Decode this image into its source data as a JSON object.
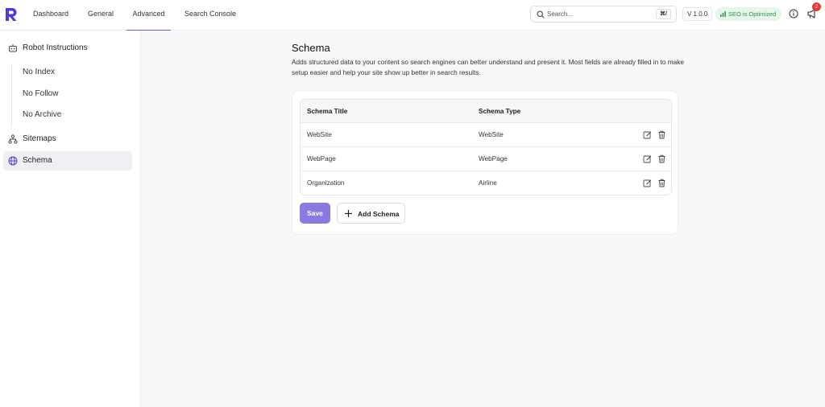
{
  "header": {
    "nav": [
      "Dashboard",
      "General",
      "Advanced",
      "Search Console"
    ],
    "active_tab": "Advanced",
    "search_placeholder": "Search...",
    "shortcut": "⌘/",
    "version": "V 1.0.0",
    "seo_status": "SEO is Optimized",
    "notification_count": "2",
    "accent_color": "#6b5cd6"
  },
  "sidebar": {
    "robot": "Robot Instructions",
    "robot_items": [
      "No Index",
      "No Follow",
      "No Archive"
    ],
    "sitemaps": "Sitemaps",
    "schema": "Schema"
  },
  "main": {
    "title": "Schema",
    "description": "Adds structured data to your content so search engines can better understand and present it. Most fields are already filled in to make setup easier and help your site show up better in search results.",
    "columns": [
      "Schema Title",
      "Schema Type"
    ],
    "rows": [
      {
        "title": "WebSite",
        "type": "WebSite"
      },
      {
        "title": "WebPage",
        "type": "WebPage"
      },
      {
        "title": "Organization",
        "type": "Airline"
      }
    ],
    "save_label": "Save",
    "add_label": "Add Schema"
  }
}
